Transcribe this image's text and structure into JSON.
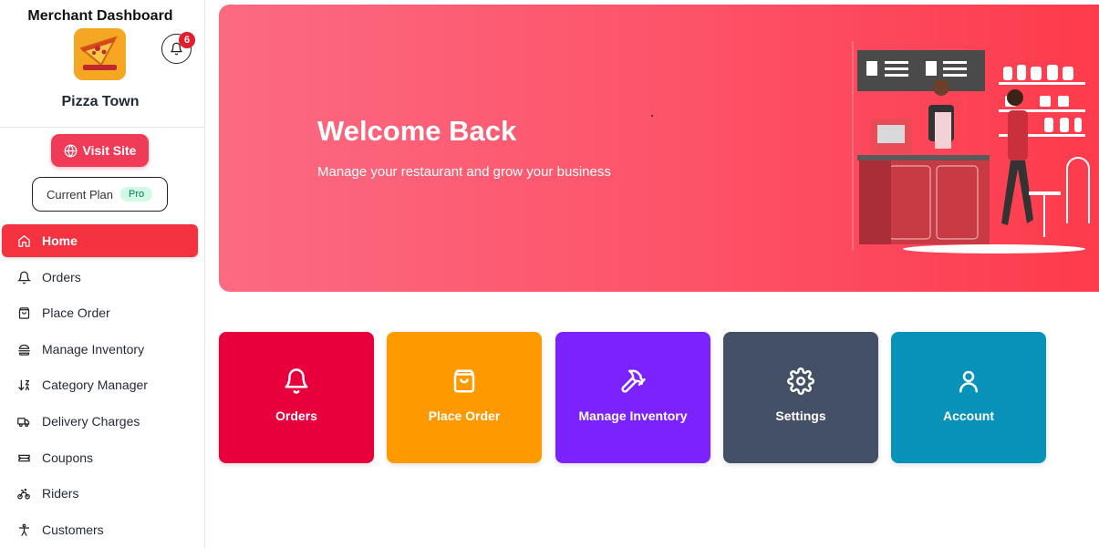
{
  "sidebar": {
    "title": "Merchant Dashboard",
    "notification_count": "6",
    "store_name": "Pizza Town",
    "visit_site_label": "Visit Site",
    "current_plan_label": "Current Plan",
    "plan_badge": "Pro",
    "nav": [
      {
        "label": "Home",
        "icon": "home-icon",
        "active": true
      },
      {
        "label": "Orders",
        "icon": "bell-icon"
      },
      {
        "label": "Place Order",
        "icon": "shopping-bag-icon"
      },
      {
        "label": "Manage Inventory",
        "icon": "burger-icon"
      },
      {
        "label": "Category Manager",
        "icon": "sort-icon"
      },
      {
        "label": "Delivery Charges",
        "icon": "truck-icon"
      },
      {
        "label": "Coupons",
        "icon": "ticket-icon"
      },
      {
        "label": "Riders",
        "icon": "bike-icon"
      },
      {
        "label": "Customers",
        "icon": "person-icon"
      }
    ]
  },
  "hero": {
    "title": "Welcome Back",
    "subtitle": "Manage your restaurant and grow your business"
  },
  "cards": [
    {
      "label": "Orders",
      "icon": "bell-icon",
      "color": "#e8003d"
    },
    {
      "label": "Place Order",
      "icon": "shopping-bag-icon",
      "color": "#ff9900"
    },
    {
      "label": "Manage Inventory",
      "icon": "hammer-icon",
      "color": "#7c22ff"
    },
    {
      "label": "Settings",
      "icon": "gear-icon",
      "color": "#445066"
    },
    {
      "label": "Account",
      "icon": "user-icon",
      "color": "#0892b9"
    }
  ],
  "colors": {
    "accent": "#f5323f",
    "visit_button": "#ef3b57",
    "plan_badge_bg": "#d1fae5"
  }
}
